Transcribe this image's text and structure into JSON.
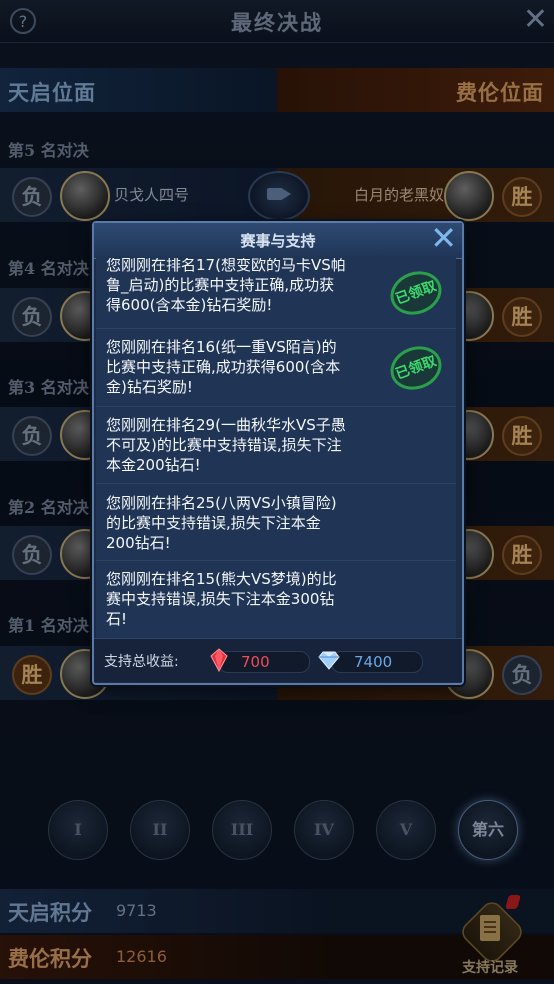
{
  "header": {
    "title": "最终决战",
    "help_icon": "?"
  },
  "factions": {
    "left": "天启位面",
    "right": "费伦位面"
  },
  "rankings": [
    {
      "label": "第5 名对决",
      "left_result": "负",
      "left_name": "贝戈人四号",
      "right_name": "白月的老黑奴",
      "right_result": "胜"
    },
    {
      "label": "第4 名对决",
      "left_result": "负",
      "right_result": "胜"
    },
    {
      "label": "第3 名对决",
      "left_result": "负",
      "right_result": "胜"
    },
    {
      "label": "第2 名对决",
      "left_result": "负",
      "right_result": "胜"
    },
    {
      "label": "第1 名对决",
      "left_result": "胜",
      "right_result": "负"
    }
  ],
  "rounds": [
    "I",
    "II",
    "III",
    "IV",
    "V",
    "第六"
  ],
  "scores": {
    "sky_label": "天启积分",
    "sky_value": "9713",
    "fei_label": "费伦积分",
    "fei_value": "12616"
  },
  "record_button": {
    "label": "支持记录"
  },
  "modal": {
    "title": "赛事与支持",
    "messages": [
      {
        "text": "您刚刚在排名17(想变欧的马卡VS帕鲁_启动)的比赛中支持正确,成功获得600(含本金)钻石奖励!",
        "stamp": "已领取"
      },
      {
        "text": "您刚刚在排名16(纸一重VS陌言)的比赛中支持正确,成功获得600(含本金)钻石奖励!",
        "stamp": "已领取"
      },
      {
        "text": "您刚刚在排名29(一曲秋华水VS子愚不可及)的比赛中支持错误,损失下注本金200钻石!",
        "stamp": ""
      },
      {
        "text": "您刚刚在排名25(八两VS小镇冒险)的比赛中支持错误,损失下注本金200钻石!",
        "stamp": ""
      },
      {
        "text": "您刚刚在排名15(熊大VS梦境)的比赛中支持错误,损失下注本金300钻石!",
        "stamp": ""
      }
    ],
    "footer": {
      "label": "支持总收益:",
      "ruby_value": "700",
      "diamond_value": "7400"
    }
  },
  "colors": {
    "win": "#f3c27c",
    "lose": "#95a5ba",
    "stamp_green": "#3bd86a",
    "ruby": "#ef4d58",
    "diamond": "#6aa8e8"
  }
}
